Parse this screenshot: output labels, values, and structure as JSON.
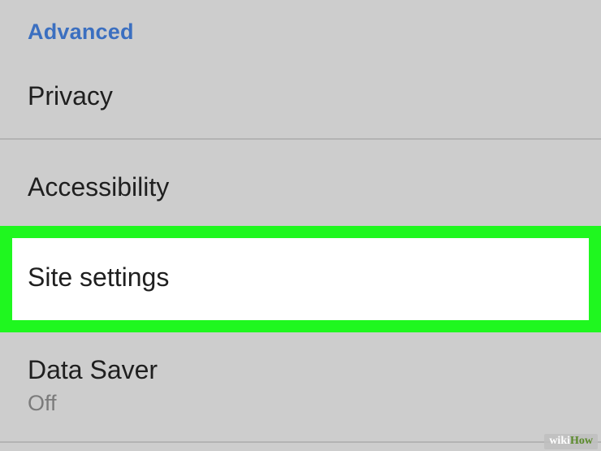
{
  "settings": {
    "section_header": "Advanced",
    "items": [
      {
        "label": "Privacy"
      },
      {
        "label": "Accessibility"
      },
      {
        "label": "Site settings",
        "highlighted": true
      },
      {
        "label": "Data Saver",
        "sublabel": "Off"
      }
    ]
  },
  "watermark": {
    "part1": "wiki",
    "part2": "How"
  },
  "colors": {
    "background": "#cdcdcd",
    "section_header": "#3b6fc0",
    "highlight_border": "#1ff71f",
    "highlight_fill": "#ffffff"
  }
}
